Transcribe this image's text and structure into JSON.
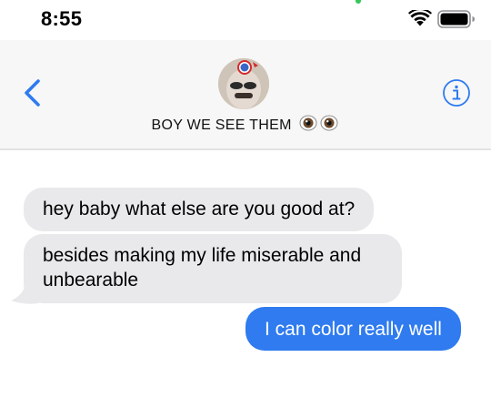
{
  "status_bar": {
    "time": "8:55"
  },
  "header": {
    "contact_name": "BOY WE SEE THEM",
    "name_emoji": "eyes-emoji",
    "back_icon": "chevron-left-icon",
    "info_icon": "info-circle-icon"
  },
  "messages": [
    {
      "direction": "incoming",
      "text": "hey baby what else are you good at?"
    },
    {
      "direction": "incoming",
      "text": "besides making my life miserable and unbearable"
    },
    {
      "direction": "outgoing",
      "text": "I can color really well"
    }
  ],
  "colors": {
    "outgoing_bubble": "#2f7bef",
    "incoming_bubble": "#e9e9eb",
    "accent": "#2f7bef"
  }
}
